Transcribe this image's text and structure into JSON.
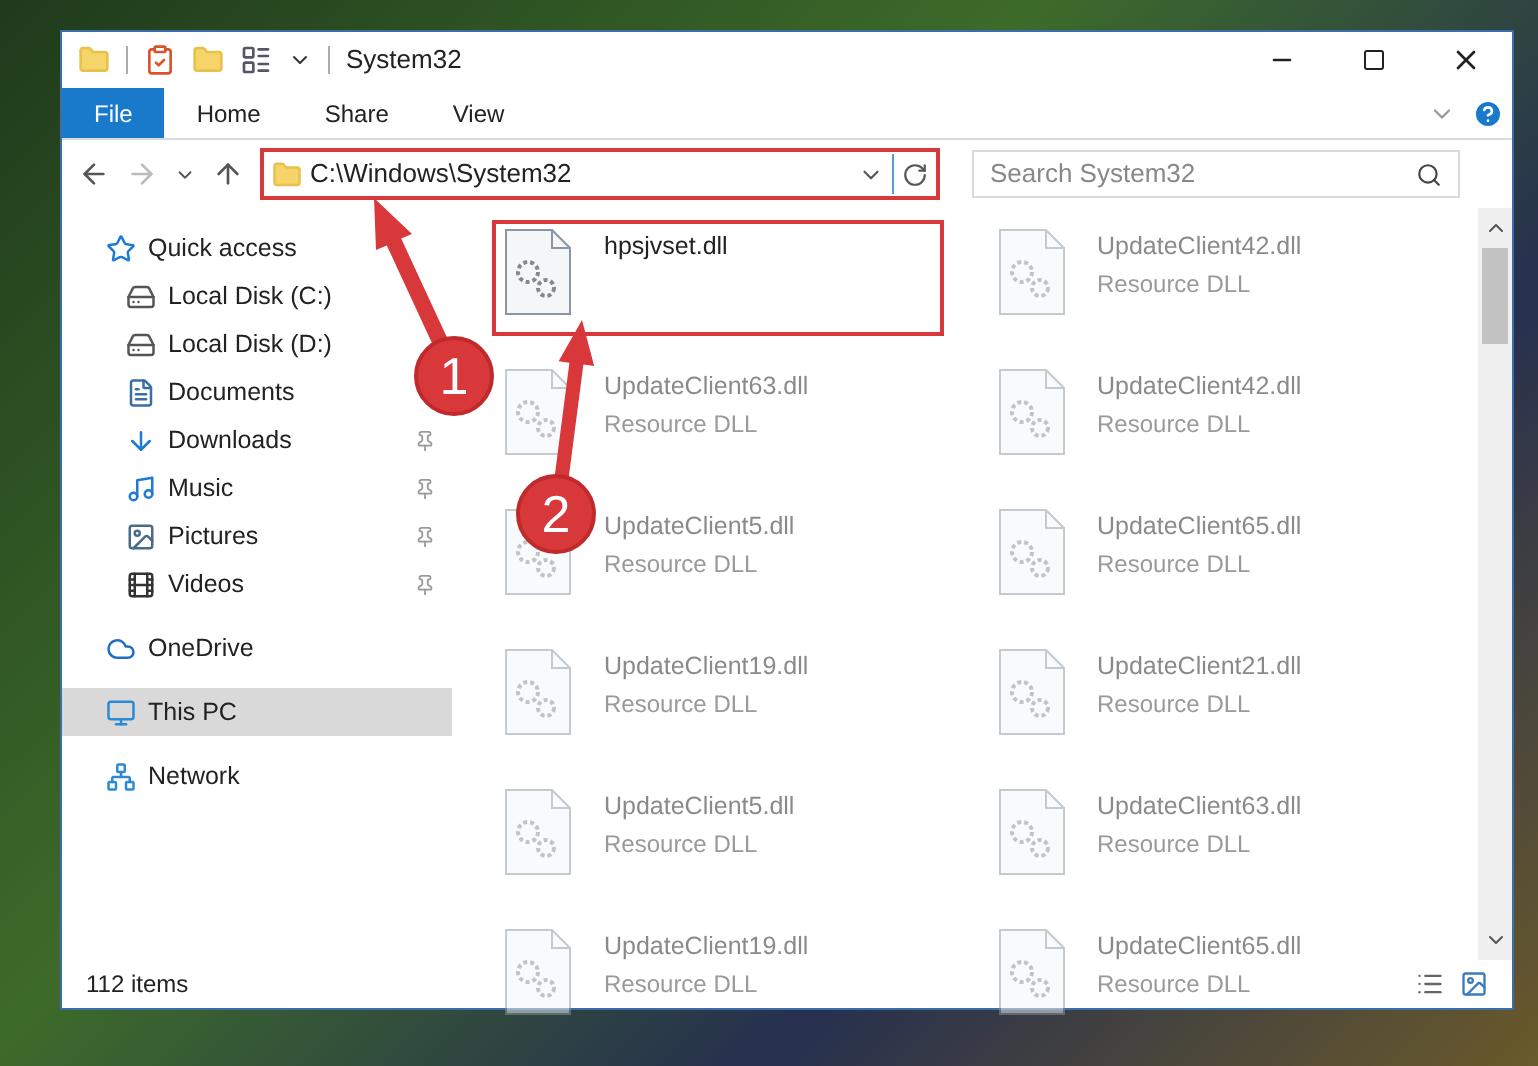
{
  "window": {
    "title": "System32"
  },
  "ribbon_tabs": [
    {
      "label": "File",
      "selected": true
    },
    {
      "label": "Home",
      "selected": false
    },
    {
      "label": "Share",
      "selected": false
    },
    {
      "label": "View",
      "selected": false
    }
  ],
  "address_bar": {
    "value": "C:\\Windows\\System32"
  },
  "search": {
    "placeholder": "Search System32"
  },
  "sidebar": {
    "items": [
      {
        "kind": "quick",
        "label": "Quick access",
        "selected": false,
        "children": [
          {
            "kind": "diskc",
            "label": "Local Disk (C:)"
          },
          {
            "kind": "disk",
            "label": "Local Disk (D:)"
          },
          {
            "kind": "documents",
            "label": "Documents"
          },
          {
            "kind": "downloads",
            "label": "Downloads",
            "pinned": true
          },
          {
            "kind": "music",
            "label": "Music",
            "pinned": true
          },
          {
            "kind": "pictures",
            "label": "Pictures",
            "pinned": true
          },
          {
            "kind": "videos",
            "label": "Videos",
            "pinned": true
          }
        ]
      },
      {
        "kind": "onedrive",
        "label": "OneDrive",
        "selected": false
      },
      {
        "kind": "pc",
        "label": "This PC",
        "selected": true
      },
      {
        "kind": "network",
        "label": "Network",
        "selected": false
      }
    ]
  },
  "files": [
    {
      "name": "hpsjvset.dll",
      "dimmed": false
    },
    {
      "name": "UpdateClient42.dll",
      "type": "Resource DLL",
      "dimmed": true
    },
    {
      "name": "UpdateClient63.dll",
      "type": "Resource DLL",
      "dimmed": true
    },
    {
      "name": "UpdateClient42.dll",
      "type": "Resource DLL",
      "dimmed": true
    },
    {
      "name": "UpdateClient5.dll",
      "type": "Resource DLL",
      "dimmed": true
    },
    {
      "name": "UpdateClient65.dll",
      "type": "Resource DLL",
      "dimmed": true
    },
    {
      "name": "UpdateClient19.dll",
      "type": "Resource DLL",
      "dimmed": true
    },
    {
      "name": "UpdateClient21.dll",
      "type": "Resource DLL",
      "dimmed": true
    },
    {
      "name": "UpdateClient5.dll",
      "type": "Resource DLL",
      "dimmed": true
    },
    {
      "name": "UpdateClient63.dll",
      "type": "Resource DLL",
      "dimmed": true
    },
    {
      "name": "UpdateClient19.dll",
      "type": "Resource DLL",
      "dimmed": true
    },
    {
      "name": "UpdateClient65.dll",
      "type": "Resource DLL",
      "dimmed": true
    }
  ],
  "status_bar": {
    "text": "112 items"
  },
  "annotations": [
    {
      "number": "1"
    },
    {
      "number": "2"
    }
  ]
}
